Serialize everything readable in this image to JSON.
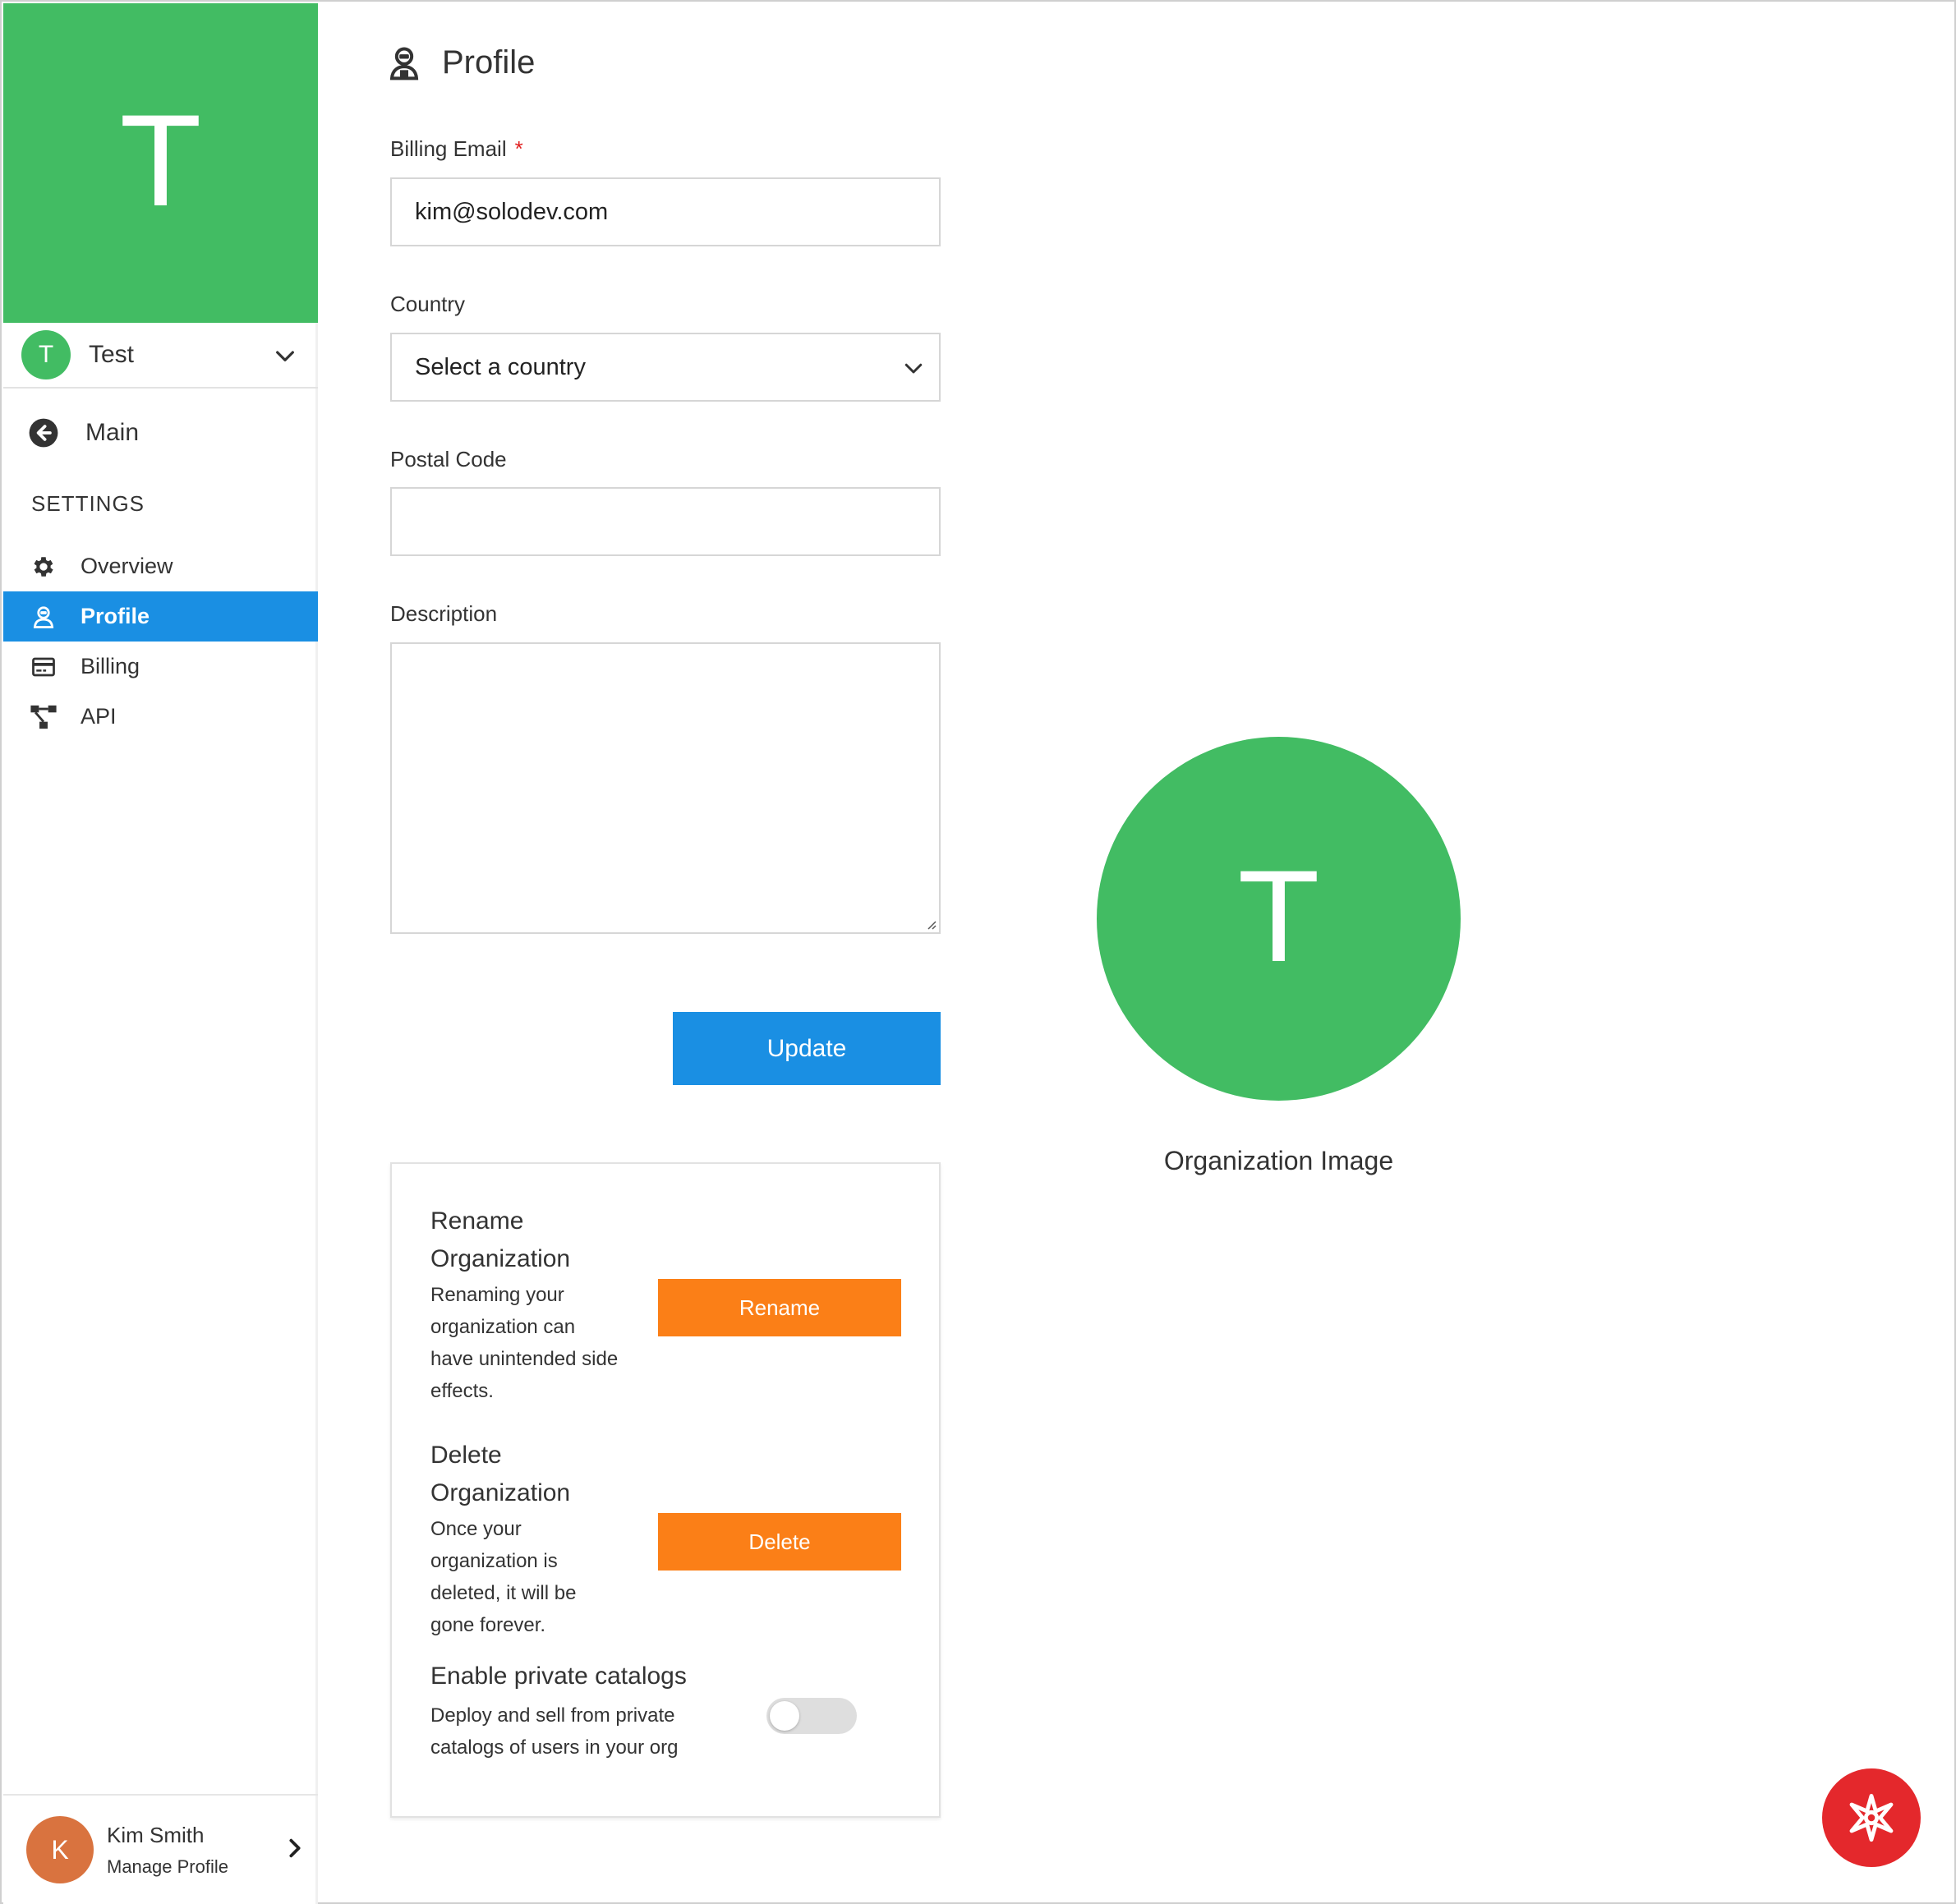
{
  "org": {
    "initial": "T",
    "name": "Test"
  },
  "sidebar": {
    "main_label": "Main",
    "settings_heading": "SETTINGS",
    "items": [
      {
        "label": "Overview",
        "icon": "gear-icon",
        "active": false
      },
      {
        "label": "Profile",
        "icon": "user-icon",
        "active": true
      },
      {
        "label": "Billing",
        "icon": "credit-card-icon",
        "active": false
      },
      {
        "label": "API",
        "icon": "api-network-icon",
        "active": false
      }
    ]
  },
  "user": {
    "initial": "K",
    "name": "Kim Smith",
    "sub": "Manage Profile"
  },
  "page": {
    "title": "Profile"
  },
  "form": {
    "billing_email": {
      "label": "Billing Email",
      "required_mark": "*",
      "value": "kim@solodev.com"
    },
    "country": {
      "label": "Country",
      "value": "Select a country"
    },
    "postal_code": {
      "label": "Postal Code",
      "value": ""
    },
    "description": {
      "label": "Description",
      "value": ""
    },
    "update_label": "Update"
  },
  "danger": {
    "rename": {
      "title_line1": "Rename",
      "title_line2": "Organization",
      "desc_lines": [
        "Renaming your",
        "organization can",
        "have unintended side",
        "effects."
      ],
      "button": "Rename"
    },
    "delete": {
      "title_line1": "Delete",
      "title_line2": "Organization",
      "desc_lines": [
        "Once your",
        "organization is",
        "deleted, it will be",
        "gone forever."
      ],
      "button": "Delete"
    },
    "catalogs": {
      "title": "Enable private catalogs",
      "desc_lines": [
        "Deploy and sell from private",
        "catalogs of users in your org"
      ],
      "enabled": false
    }
  },
  "org_image": {
    "initial": "T",
    "caption": "Organization Image"
  },
  "colors": {
    "green": "#42bc63",
    "blue": "#1a8fe3",
    "orange": "#fb7f17",
    "red": "#e4282c",
    "user_avatar": "#d9733f"
  }
}
